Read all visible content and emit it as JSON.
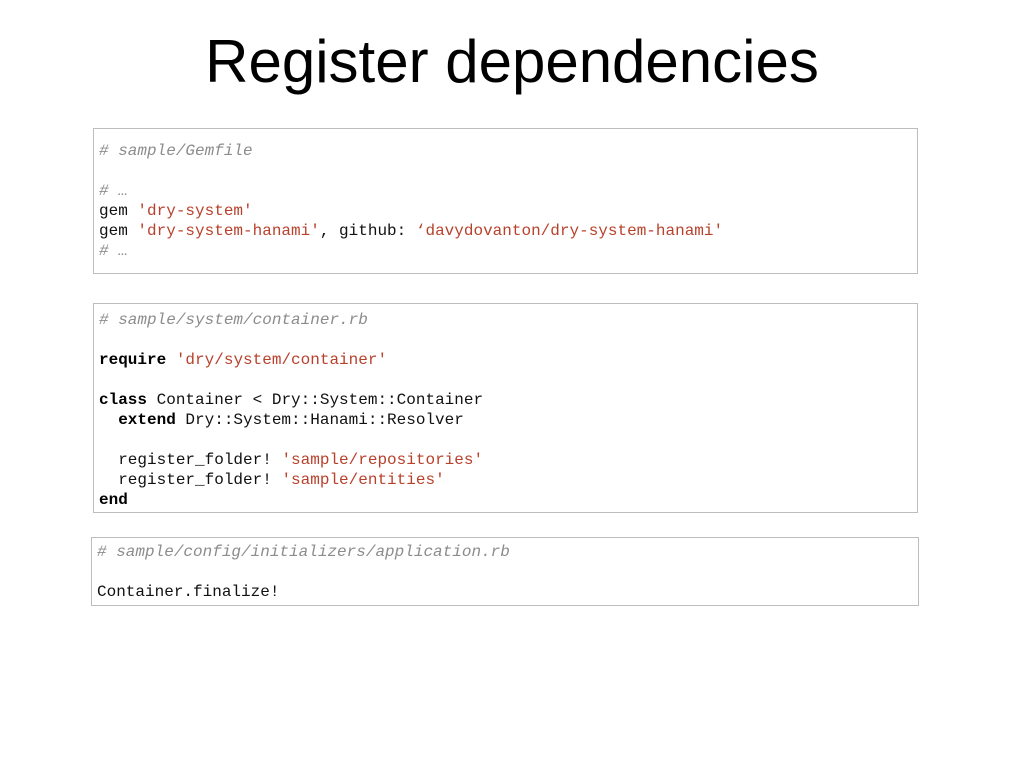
{
  "slide": {
    "title": "Register dependencies"
  },
  "gemfile": {
    "comment_path": "# sample/Gemfile",
    "comment_ellipsis_top": "# …",
    "line1_plain": "gem ",
    "line1_str": "'dry-system'",
    "line2_plain": "gem ",
    "line2_str1": "'dry-system-hanami'",
    "line2_plain2": ", github: ",
    "line2_str2": "‘davydovanton/dry-system-hanami'",
    "comment_ellipsis_bottom": "# …"
  },
  "container": {
    "comment_path": "# sample/system/container.rb",
    "require_kw": "require",
    "require_str": "'dry/system/container'",
    "class_kw": "class",
    "class_rest": " Container < Dry::System::Container",
    "extend_indent": "  ",
    "extend_kw": "extend",
    "extend_rest": " Dry::System::Hanami::Resolver",
    "reg1_plain": "  register_folder! ",
    "reg1_str": "'sample/repositories'",
    "reg2_plain": "  register_folder! ",
    "reg2_str": "'sample/entities'",
    "end_kw": "end"
  },
  "initializer": {
    "comment_path": "# sample/config/initializers/application.rb",
    "finalize_line": "Container.finalize!"
  },
  "colors": {
    "string": "#b8412c",
    "comment": "#8c8c8c",
    "border": "#bdbdbd"
  }
}
